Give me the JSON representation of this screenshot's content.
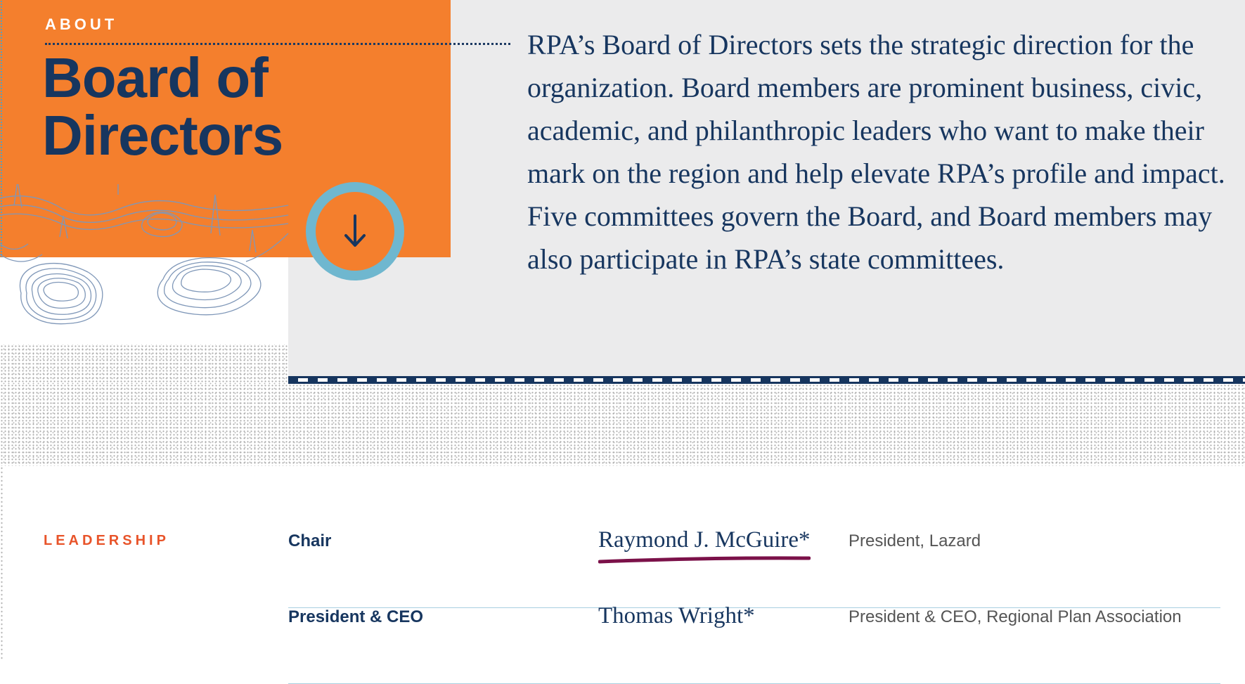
{
  "header": {
    "eyebrow": "ABOUT",
    "title": "Board of Directors",
    "intro": "RPA’s Board of Directors sets the strategic direction for the organization. Board members are prominent business, civic, academic, and philanthropic leaders who want to make their mark on the region and help elevate RPA’s profile and impact. Five committees govern the Board, and Board members may also participate in RPA’s state committees.",
    "scroll_icon": "arrow-down-icon"
  },
  "colors": {
    "orange": "#f47f2d",
    "navy": "#17365f",
    "grey_panel": "#ebebec",
    "ring_blue": "#6fb7cf",
    "label_orange": "#e8542a",
    "underline_maroon": "#7b1149"
  },
  "leadership": {
    "label": "LEADERSHIP",
    "rows": [
      {
        "role": "Chair",
        "name": "Raymond J. McGuire*",
        "affiliation": "President, Lazard"
      },
      {
        "role": "President & CEO",
        "name": "Thomas Wright*",
        "affiliation": "President & CEO, Regional Plan Association"
      }
    ]
  }
}
